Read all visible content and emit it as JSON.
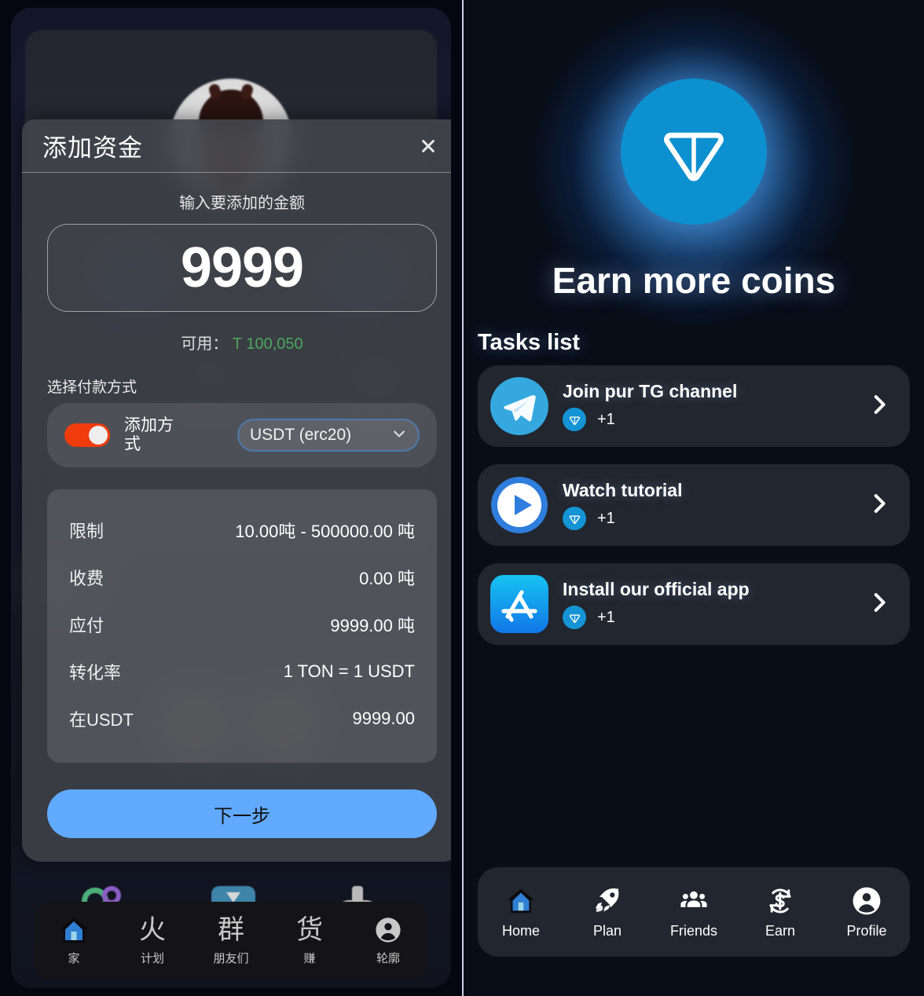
{
  "left_app": {
    "modal": {
      "title": "添加资金",
      "close_icon": "close-icon",
      "amount_label": "输入要添加的金额",
      "amount_value": "9999",
      "available_label": "可用：",
      "available_value": "T 100,050",
      "available_color": "#4aa85c",
      "payment_section_label": "选择付款方式",
      "toggle": {
        "label": "添加方式",
        "state": "on",
        "color": "#f03c0c"
      },
      "select": {
        "value": "USDT (erc20)",
        "chevron": "chevron-down-icon",
        "border_color": "#4d79ad"
      },
      "info_rows": [
        {
          "key": "限制",
          "value": "10.00吨 - 500000.00 吨"
        },
        {
          "key": "收费",
          "value": "0.00 吨"
        },
        {
          "key": "应付",
          "value": "9999.00 吨"
        },
        {
          "key": "转化率",
          "value": "1 TON = 1 USDT"
        },
        {
          "key": "在USDT",
          "value": "9999.00"
        }
      ],
      "next_button": {
        "label": "下一步",
        "color": "#61aaff"
      }
    },
    "bottom_nav": [
      {
        "icon": "home-icon",
        "glyph": "",
        "label": "家",
        "active": true
      },
      {
        "icon": "fire-glyph-icon",
        "glyph": "火",
        "label": "计划",
        "active": false
      },
      {
        "icon": "group-glyph-icon",
        "glyph": "群",
        "label": "朋友们",
        "active": false
      },
      {
        "icon": "goods-glyph-icon",
        "glyph": "货",
        "label": "赚",
        "active": false
      },
      {
        "icon": "profile-icon",
        "glyph": "",
        "label": "轮廓",
        "active": false
      }
    ]
  },
  "right_app": {
    "hero": {
      "coin_icon": "ton-coin-icon",
      "coin_color": "#0d90cf",
      "title": "Earn more coins"
    },
    "tasks_heading": "Tasks list",
    "tasks": [
      {
        "icon": "telegram-icon",
        "title": "Join pur TG channel",
        "reward_icon": "ton-coin-icon",
        "reward": "+1",
        "chevron": "chevron-right-icon"
      },
      {
        "icon": "play-circle-icon",
        "title": "Watch tutorial",
        "reward_icon": "ton-coin-icon",
        "reward": "+1",
        "chevron": "chevron-right-icon"
      },
      {
        "icon": "app-store-icon",
        "title": "Install our official app",
        "reward_icon": "ton-coin-icon",
        "reward": "+1",
        "chevron": "chevron-right-icon"
      }
    ],
    "bottom_nav": [
      {
        "icon": "home-icon",
        "label": "Home",
        "active": true
      },
      {
        "icon": "rocket-icon",
        "label": "Plan",
        "active": false
      },
      {
        "icon": "friends-icon",
        "label": "Friends",
        "active": false
      },
      {
        "icon": "earn-refresh-dollar-icon",
        "label": "Earn",
        "active": false
      },
      {
        "icon": "profile-icon",
        "label": "Profile",
        "active": false
      }
    ]
  }
}
